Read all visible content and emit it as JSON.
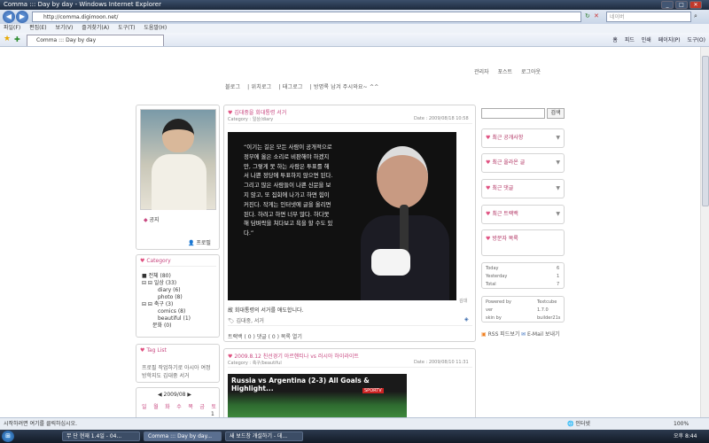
{
  "window": {
    "title": "Comma ::: Day by day - Windows Internet Explorer"
  },
  "address": {
    "url": "http://comma.digimoon.net/",
    "search_placeholder": "네이버"
  },
  "menu": [
    "파일(F)",
    "편집(E)",
    "보기(V)",
    "즐겨찾기(A)",
    "도구(T)",
    "도움말(H)"
  ],
  "tab": {
    "label": "Comma ::: Day by day"
  },
  "toolbar": [
    "홈",
    "피드",
    "인쇄",
    "페이지(P)",
    "도구(O)"
  ],
  "blog": {
    "toplinks": [
      "관리자",
      "포스트",
      "로그아웃"
    ],
    "nav": [
      "블로그",
      "위치로그",
      "태그로그",
      "방명록 남겨 주시와요~ ^^"
    ],
    "profile_link": "공지",
    "profile_name": "프로필",
    "category_title": "Category",
    "categories": [
      "전체 (80)",
      "일상 (33)",
      "diary (6)",
      "photo (8)",
      "축구 (3)",
      "comics (8)",
      "beautiful (1)",
      "문화 (0)"
    ],
    "taglist_title": "Tag List",
    "tags": [
      "프로필",
      "작업하기로",
      "아시아",
      "여정",
      "방학지도",
      "김대중",
      "서거"
    ],
    "calendar": {
      "title": "2009/08",
      "nav": "◀ 2009/08 ▶",
      "days": [
        "일",
        "월",
        "화",
        "수",
        "목",
        "금",
        "토"
      ],
      "first_day": "1"
    },
    "search_button": "검색",
    "sidebar_boxes": [
      "최근 공개사항",
      "최근 올라온 글",
      "최근 댓글",
      "최근 트랙백",
      "방문자 목록"
    ],
    "stats": [
      {
        "label": "Today",
        "value": "6"
      },
      {
        "label": "Yesterday",
        "value": "1"
      },
      {
        "label": "Total",
        "value": "7"
      }
    ],
    "powered": [
      {
        "label": "Powered by",
        "value": "Textcube"
      },
      {
        "label": "ver",
        "value": "1.7.0"
      },
      {
        "label": "skin by",
        "value": "builder21s"
      }
    ],
    "rss": "RSS 피드보기",
    "email": "E-Mail 보내기",
    "post1": {
      "title": "김대중을 회대통령 서거",
      "category": "Category : 일상/diary",
      "date": "Date : 2009/08/18 10:58",
      "quote": "“이기는 길은 모든 사람이 공개적으로 정부에 옳은 소리로 비판해야 하겠지만, 그렇게 못 하는 사람은 투표를 해서 나쁜 정당에 투표하지 않으면 된다. 그리고 많은 사람들이 나쁜 신문을 보지 않고, 또 집회에 나가고 하면 힘이 커진다. 작게는 인터넷에 글을 올리면 된다. 하려고 하면 너무 많다. 하다못해 담벼락을 쳐다보고 욕을 할 수도 있다.”",
      "caption": "김대",
      "body": "故 회대통령의 서거를 애도합니다.",
      "tags": "김대중, 서거",
      "footer": "트랙백 ( 0 ) 댓글 ( 0 ) 목록 열기"
    },
    "post2": {
      "title": "2009.8.12 친선경기 아르헨티나 vs 러시아 하이라이트",
      "category": "Category : 축구/beautiful",
      "date": "Date : 2009/08/10 11:31",
      "video_title": "Russia vs Argentina (2-3) All Goals & Highlight...",
      "video_logo": "SPORTV"
    }
  },
  "status": {
    "text": "시작하려면 여기를 클릭하십시오.",
    "zone": "인터넷",
    "zoom": "100%"
  },
  "taskbar": {
    "items": [
      "무 단 현재 1.4일 - 04...",
      "Comma ::: Day by day...",
      "새 보드창 개설하기 - 데..."
    ],
    "clock": "오후 8:44"
  }
}
